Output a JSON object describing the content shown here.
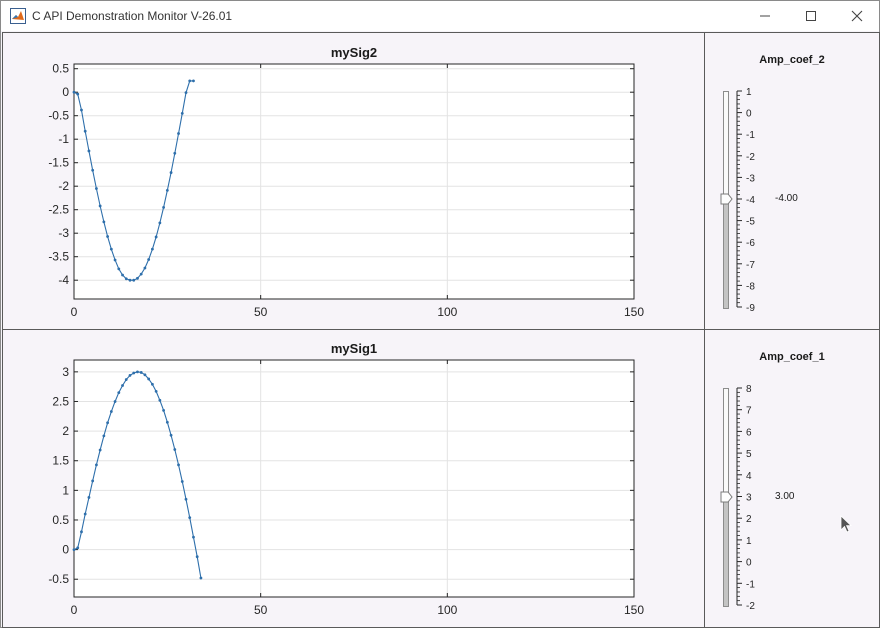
{
  "window": {
    "title": "C API Demonstration Monitor V-26.01",
    "controls": {
      "minimize": "minimize-icon",
      "maximize": "maximize-icon",
      "close": "close-icon"
    }
  },
  "plots": [
    {
      "chart_data": {
        "type": "line",
        "title": "mySig2",
        "xlim": [
          0,
          150
        ],
        "ylim": [
          -4.4,
          0.6
        ],
        "xticks": [
          0,
          50,
          100,
          150
        ],
        "yticks": [
          0.5,
          0,
          -0.5,
          -1,
          -1.5,
          -2,
          -2.5,
          -3,
          -3.5,
          -4
        ],
        "ytick_labels": [
          "0.5",
          "0",
          "-0.5",
          "-1",
          "-1.5",
          "-2",
          "-2.5",
          "-3",
          "-3.5",
          "-4"
        ],
        "grid": true,
        "series": [
          {
            "color": "#2e6fab",
            "marker": "dot",
            "x": [
              0,
              1,
              2,
              3,
              4,
              5,
              6,
              7,
              8,
              9,
              10,
              11,
              12,
              13,
              14,
              15,
              16,
              17,
              18,
              19,
              20,
              21,
              22,
              23,
              24,
              25,
              26,
              27,
              28,
              29,
              30,
              31,
              32
            ],
            "y": [
              0,
              -0.04,
              -0.38,
              -0.83,
              -1.25,
              -1.66,
              -2.05,
              -2.42,
              -2.76,
              -3.07,
              -3.34,
              -3.57,
              -3.76,
              -3.89,
              -3.97,
              -4.0,
              -4.0,
              -3.96,
              -3.87,
              -3.74,
              -3.56,
              -3.34,
              -3.08,
              -2.78,
              -2.45,
              -2.09,
              -1.71,
              -1.3,
              -0.88,
              -0.45,
              -0.01,
              0.24,
              0.24
            ]
          }
        ]
      }
    },
    {
      "chart_data": {
        "type": "line",
        "title": "mySig1",
        "xlim": [
          0,
          150
        ],
        "ylim": [
          -0.8,
          3.2
        ],
        "xticks": [
          0,
          50,
          100,
          150
        ],
        "yticks": [
          3,
          2.5,
          2,
          1.5,
          1,
          0.5,
          0,
          -0.5
        ],
        "ytick_labels": [
          "3",
          "2.5",
          "2",
          "1.5",
          "1",
          "0.5",
          "0",
          "-0.5"
        ],
        "grid": true,
        "series": [
          {
            "color": "#2e6fab",
            "marker": "dot",
            "x": [
              0,
              1,
              2,
              3,
              4,
              5,
              6,
              7,
              8,
              9,
              10,
              11,
              12,
              13,
              14,
              15,
              16,
              17,
              18,
              19,
              20,
              21,
              22,
              23,
              24,
              25,
              26,
              27,
              28,
              29,
              30,
              31,
              32,
              33,
              34
            ],
            "y": [
              0,
              0.03,
              0.3,
              0.6,
              0.88,
              1.16,
              1.43,
              1.68,
              1.92,
              2.14,
              2.33,
              2.5,
              2.65,
              2.77,
              2.87,
              2.94,
              2.98,
              3.0,
              2.99,
              2.95,
              2.88,
              2.79,
              2.67,
              2.52,
              2.35,
              2.15,
              1.93,
              1.69,
              1.43,
              1.15,
              0.85,
              0.54,
              0.21,
              -0.12,
              -0.48
            ]
          }
        ]
      }
    }
  ],
  "sliders": [
    {
      "label": "Amp_coef_2",
      "value_text": "-4.00",
      "value": -4,
      "min": -9,
      "max": 1,
      "tick_labels": [
        "1",
        "0",
        "-1",
        "-2",
        "-3",
        "-4",
        "-5",
        "-6",
        "-7",
        "-8",
        "-9"
      ]
    },
    {
      "label": "Amp_coef_1",
      "value_text": "3.00",
      "value": 3,
      "min": -2,
      "max": 8,
      "tick_labels": [
        "8",
        "7",
        "6",
        "5",
        "4",
        "3",
        "2",
        "1",
        "0",
        "-1",
        "-2"
      ]
    }
  ]
}
